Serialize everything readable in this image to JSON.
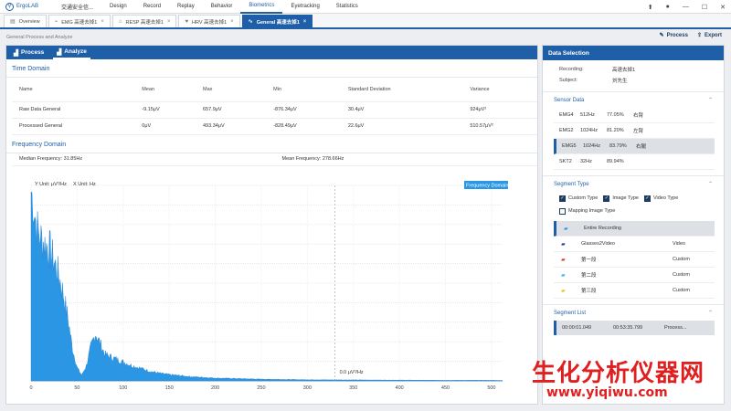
{
  "app": {
    "name": "ErgoLAB"
  },
  "menu": {
    "items": [
      "交通安全信...",
      "Design",
      "Record",
      "Replay",
      "Behavior",
      "Biometrics",
      "Eyetracking",
      "Statistics"
    ],
    "active": "Biometrics"
  },
  "tabs": [
    {
      "label": "Overview",
      "icon": "document-icon"
    },
    {
      "label": "EMG 高速去掉1",
      "icon": "emg-icon"
    },
    {
      "label": "RESP 高速去掉1",
      "icon": "resp-icon"
    },
    {
      "label": "HRV 高速去掉1",
      "icon": "heart-icon"
    },
    {
      "label": "General 高速去掉1",
      "icon": "general-icon",
      "active": true
    }
  ],
  "subheader": "General Process and Analyze",
  "actions": {
    "process": "Process",
    "export": "Export"
  },
  "panel_tabs": {
    "process": "Process",
    "analyze": "Analyze"
  },
  "time_domain": {
    "title": "Time Domain",
    "columns": [
      "Name",
      "Mean",
      "Max",
      "Min",
      "Standard Deviation",
      "Variance"
    ],
    "rows": [
      [
        "Raw Data General",
        "-9.15μV",
        "657.9μV",
        "-876.34μV",
        "30.4μV",
        "924μV²"
      ],
      [
        "Processed General",
        "0μV",
        "493.34μV",
        "-828.49μV",
        "22.6μV",
        "510.57μV²"
      ]
    ]
  },
  "frequency_domain": {
    "title": "Frequency Domain",
    "median_label": "Median Frequency:",
    "median_value": "31.85Hz",
    "mean_label": "Mean Frequency:",
    "mean_value": "278.66Hz"
  },
  "chart_data": {
    "type": "area",
    "legend": "Frequency Domain",
    "y_axis_label": "Y Unit: μV²/Hz",
    "x_axis_label": "X Unit: Hz",
    "x_ticks": [
      "0",
      "50",
      "100",
      "150",
      "200",
      "250",
      "300",
      "350",
      "400",
      "450",
      "500"
    ],
    "xlim": [
      0,
      512
    ],
    "marker_value": 330,
    "marker_label": "0.0 μV²/Hz",
    "color": "#2b97e4",
    "x": [
      0,
      2,
      4,
      6,
      8,
      10,
      15,
      20,
      25,
      30,
      35,
      40,
      45,
      50,
      55,
      60,
      65,
      70,
      75,
      80,
      90,
      100,
      110,
      120,
      130,
      140,
      150,
      175,
      200,
      250,
      300,
      350,
      400,
      450,
      500,
      512
    ],
    "y": [
      1.0,
      0.95,
      0.88,
      0.82,
      0.78,
      0.76,
      0.72,
      0.7,
      0.63,
      0.56,
      0.46,
      0.33,
      0.17,
      0.07,
      0.03,
      0.08,
      0.18,
      0.25,
      0.2,
      0.14,
      0.12,
      0.1,
      0.08,
      0.065,
      0.05,
      0.04,
      0.033,
      0.022,
      0.015,
      0.009,
      0.006,
      0.005,
      0.004,
      0.003,
      0.003,
      0.002
    ]
  },
  "data_selection": {
    "title": "Data Selection",
    "recording_label": "Recording:",
    "recording_value": "高速去掉1",
    "subject_label": "Subject:",
    "subject_value": "刘先生"
  },
  "sensor_data": {
    "title": "Sensor Data",
    "rows": [
      [
        "EMG4",
        "512Hz",
        "77.05%",
        "右臂"
      ],
      [
        "EMG2",
        "1024Hz",
        "81.20%",
        "左臂"
      ],
      [
        "EMG5",
        "1024Hz",
        "83.79%",
        "右腿"
      ],
      [
        "SKT2",
        "32Hz",
        "89.94%",
        ""
      ]
    ],
    "selected_index": 2
  },
  "segment_type": {
    "title": "Segment Type",
    "checks": [
      {
        "label": "Custom Type",
        "checked": true
      },
      {
        "label": "Image Type",
        "checked": true
      },
      {
        "label": "Video Type",
        "checked": true
      },
      {
        "label": "Mapping Image Type",
        "checked": false
      }
    ],
    "segments": [
      {
        "name": "Entire Recording",
        "type": "",
        "color": "#2b97e4",
        "selected": true
      },
      {
        "name": "Glasses2Video",
        "type": "Video",
        "color": "#1f3a8f"
      },
      {
        "name": "第一段",
        "type": "Custom",
        "color": "#d23a2a"
      },
      {
        "name": "第二段",
        "type": "Custom",
        "color": "#2fb7e6"
      },
      {
        "name": "第三段",
        "type": "Custom",
        "color": "#e6c21a"
      }
    ]
  },
  "segment_list": {
    "title": "Segment List",
    "row": [
      "00:00:01.049",
      "00:53:35.799",
      "Process..."
    ]
  },
  "watermark": {
    "line1": "生化分析仪器网",
    "line2": "www.yiqiwu.com"
  }
}
